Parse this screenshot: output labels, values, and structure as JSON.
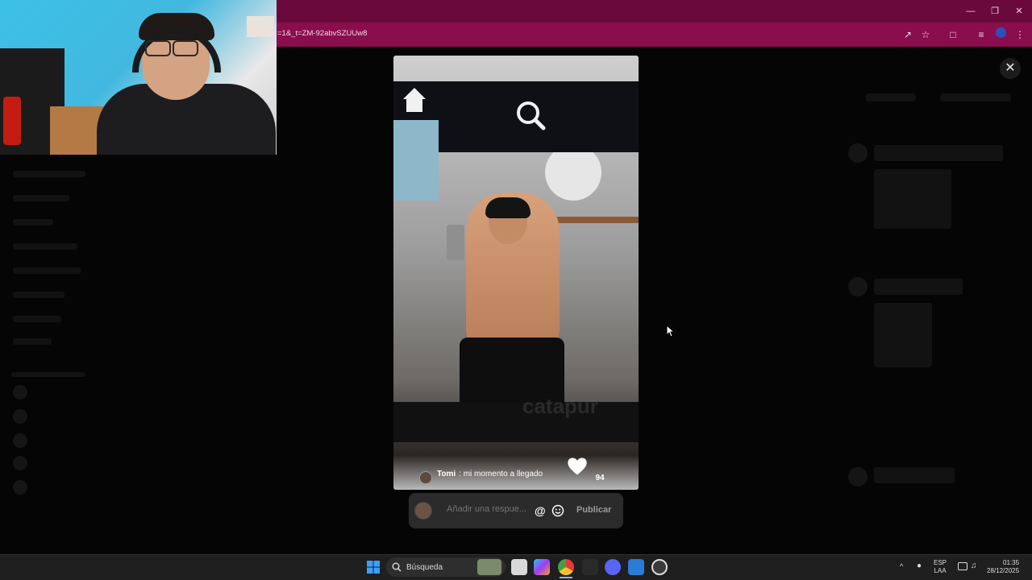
{
  "browser": {
    "url_fragment": "=1&_t=ZM-92abvSZUUw8",
    "accent": "#8a0d4e"
  },
  "story": {
    "username": "Tomi",
    "caption": "mi momento a llegado",
    "likes": "94",
    "watermark": "catapur"
  },
  "reply": {
    "placeholder": "Añadir una respue...",
    "publish_label": "Publicar"
  },
  "taskbar": {
    "search_label": "Búsqueda",
    "language_line1": "ESP",
    "language_line2": "LAA",
    "time": "01:35",
    "date": "28/12/2025"
  },
  "icons": {
    "close": "close-icon",
    "heart": "heart-icon",
    "home": "home-icon",
    "search": "search-icon"
  }
}
